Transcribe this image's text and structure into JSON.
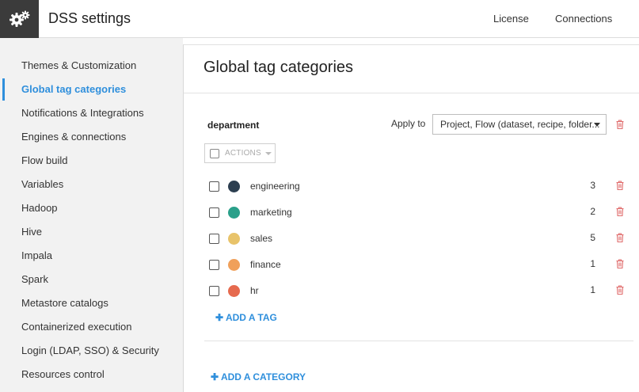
{
  "header": {
    "title": "DSS settings",
    "links": [
      "License",
      "Connections"
    ]
  },
  "sidebar": {
    "items": [
      {
        "label": "Themes & Customization"
      },
      {
        "label": "Global tag categories",
        "active": true
      },
      {
        "label": "Notifications & Integrations"
      },
      {
        "label": "Engines & connections"
      },
      {
        "label": "Flow build"
      },
      {
        "label": "Variables"
      },
      {
        "label": "Hadoop"
      },
      {
        "label": "Hive"
      },
      {
        "label": "Impala"
      },
      {
        "label": "Spark"
      },
      {
        "label": "Metastore catalogs"
      },
      {
        "label": "Containerized execution"
      },
      {
        "label": "Login (LDAP, SSO) & Security"
      },
      {
        "label": "Resources control"
      }
    ]
  },
  "main": {
    "title": "Global tag categories",
    "category": {
      "name": "department",
      "apply_label": "Apply to",
      "apply_value": "Project, Flow (dataset, recipe, folder...",
      "actions_label": "ACTIONS",
      "tags": [
        {
          "name": "engineering",
          "count": "3",
          "color": "#2c3e50"
        },
        {
          "name": "marketing",
          "count": "2",
          "color": "#2aa08a"
        },
        {
          "name": "sales",
          "count": "5",
          "color": "#e8c36a"
        },
        {
          "name": "finance",
          "count": "1",
          "color": "#f0a05a"
        },
        {
          "name": "hr",
          "count": "1",
          "color": "#e66a4e"
        }
      ],
      "add_tag_label": "ADD A TAG"
    },
    "add_category_label": "ADD A CATEGORY"
  },
  "colors": {
    "accent": "#2f8fdc",
    "danger": "#e06c6c",
    "logo_bg": "#3b3b3b"
  }
}
